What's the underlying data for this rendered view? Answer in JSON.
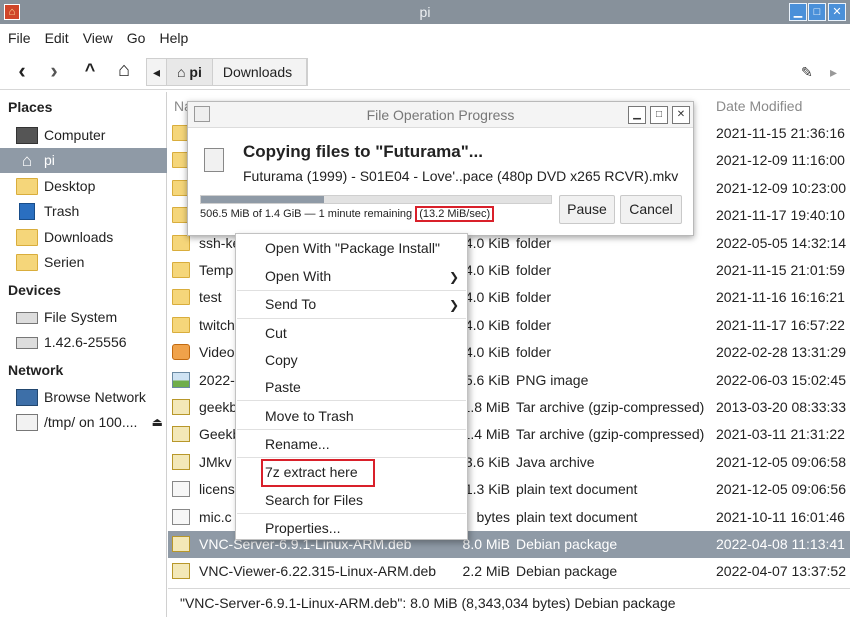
{
  "window": {
    "title": "pi"
  },
  "menubar": [
    "File",
    "Edit",
    "View",
    "Go",
    "Help"
  ],
  "pathbar": {
    "home": "pi",
    "current": "Downloads"
  },
  "sidebar": {
    "places_title": "Places",
    "places": [
      "Computer",
      "pi",
      "Desktop",
      "Trash",
      "Downloads",
      "Serien"
    ],
    "devices_title": "Devices",
    "devices": [
      "File System",
      "1.42.6-25556"
    ],
    "network_title": "Network",
    "network": [
      "Browse Network",
      "/tmp/ on 100...."
    ]
  },
  "list": {
    "header_name": "Na",
    "header_date": "Date Modified",
    "rows": [
      {
        "name": "",
        "size": "",
        "type": "",
        "date": "2021-11-15 21:36:16",
        "icon": "folder"
      },
      {
        "name": "",
        "size": "",
        "type": "",
        "date": "2021-12-09 11:16:00",
        "icon": "folder"
      },
      {
        "name": "",
        "size": "",
        "type": "",
        "date": "2021-12-09 10:23:00",
        "icon": "folder"
      },
      {
        "name": "",
        "size": "",
        "type": "",
        "date": "2021-11-17 19:40:10",
        "icon": "folder"
      },
      {
        "name": "ssh-ke",
        "size": "4.0 KiB",
        "type": "folder",
        "date": "2022-05-05 14:32:14",
        "icon": "folder"
      },
      {
        "name": "Temp",
        "size": "4.0 KiB",
        "type": "folder",
        "date": "2021-11-15 21:01:59",
        "icon": "folder"
      },
      {
        "name": "test",
        "size": "4.0 KiB",
        "type": "folder",
        "date": "2021-11-16 16:16:21",
        "icon": "folder"
      },
      {
        "name": "twitch",
        "size": "4.0 KiB",
        "type": "folder",
        "date": "2021-11-17 16:57:22",
        "icon": "folder"
      },
      {
        "name": "Video",
        "size": "4.0 KiB",
        "type": "folder",
        "date": "2022-02-28 13:31:29",
        "icon": "video-folder"
      },
      {
        "name": "2022-",
        "size": "5.6 KiB",
        "type": "PNG image",
        "date": "2022-06-03 15:02:45",
        "icon": "image"
      },
      {
        "name": "geekb",
        "size": "1.8 MiB",
        "type": "Tar archive (gzip-compressed)",
        "date": "2013-03-20 08:33:33",
        "icon": "archive"
      },
      {
        "name": "Geekb",
        "size": "1.4 MiB",
        "type": "Tar archive (gzip-compressed)",
        "date": "2021-03-11 21:31:22",
        "icon": "archive"
      },
      {
        "name": "JMkv",
        "size": "3.6 KiB",
        "type": "Java archive",
        "date": "2021-12-05 09:06:58",
        "icon": "archive"
      },
      {
        "name": "licens",
        "size": "1.3 KiB",
        "type": "plain text document",
        "date": "2021-12-05 09:06:56",
        "icon": "doc"
      },
      {
        "name": "mic.c",
        "size": "bytes",
        "type": "plain text document",
        "date": "2021-10-11 16:01:46",
        "icon": "doc"
      },
      {
        "name": "VNC-Server-6.9.1-Linux-ARM.deb",
        "size": "8.0 MiB",
        "type": "Debian package",
        "date": "2022-04-08 11:13:41",
        "icon": "archive"
      },
      {
        "name": "VNC-Viewer-6.22.315-Linux-ARM.deb",
        "size": "2.2 MiB",
        "type": "Debian package",
        "date": "2022-04-07 13:37:52",
        "icon": "archive"
      }
    ],
    "selected_index": 15
  },
  "status": "\"VNC-Server-6.9.1-Linux-ARM.deb\": 8.0 MiB (8,343,034 bytes) Debian package",
  "dialog": {
    "title": "File Operation Progress",
    "heading": "Copying files to \"Futurama\"...",
    "file": "Futurama (1999) - S01E04 - Love'..pace (480p DVD x265 RCVR).mkv",
    "progress_fraction": 0.35,
    "remaining": "506.5 MiB of 1.4 GiB — 1 minute remaining",
    "speed": "(13.2 MiB/sec)",
    "pause_label": "Pause",
    "cancel_label": "Cancel"
  },
  "context_menu": {
    "items": [
      "Open With \"Package Install\"",
      "Open With",
      "Send To",
      "Cut",
      "Copy",
      "Paste",
      "Move to Trash",
      "Rename...",
      "7z extract here",
      "Search for Files",
      "Properties..."
    ]
  },
  "colors": {
    "selection": "#8f9aa6",
    "highlight_box": "#d9202a",
    "folder": "#f5d67a"
  }
}
